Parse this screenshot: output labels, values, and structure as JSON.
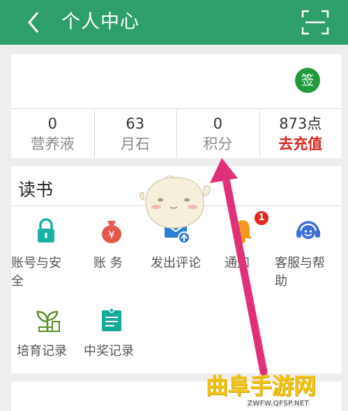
{
  "header": {
    "title": "个人中心"
  },
  "sign": {
    "label": "签"
  },
  "stats": [
    {
      "value": "0",
      "label": "营养液"
    },
    {
      "value": "63",
      "label": "月石"
    },
    {
      "value": "0",
      "label": "积分"
    },
    {
      "value": "873点",
      "label": "去充值"
    }
  ],
  "reading": {
    "section_title": "读书",
    "items": [
      {
        "label": "账号与安全",
        "icon": "lock-icon"
      },
      {
        "label": "账 务",
        "icon": "money-bag-icon"
      },
      {
        "label": "发出评论",
        "icon": "mail-upload-icon"
      },
      {
        "label": "通知",
        "icon": "bell-icon",
        "badge": "1"
      },
      {
        "label": "客服与帮助",
        "icon": "headset-icon"
      },
      {
        "label": "培育记录",
        "icon": "sprout-icon"
      },
      {
        "label": "中奖记录",
        "icon": "ticket-icon"
      }
    ]
  },
  "watermark": {
    "text": "曲阜手游网",
    "url": "ZWFW.QFSP.NET"
  },
  "colors": {
    "header": "#2e9e6a",
    "accent_red": "#d8261c",
    "annotation_arrow": "#e0307a"
  }
}
